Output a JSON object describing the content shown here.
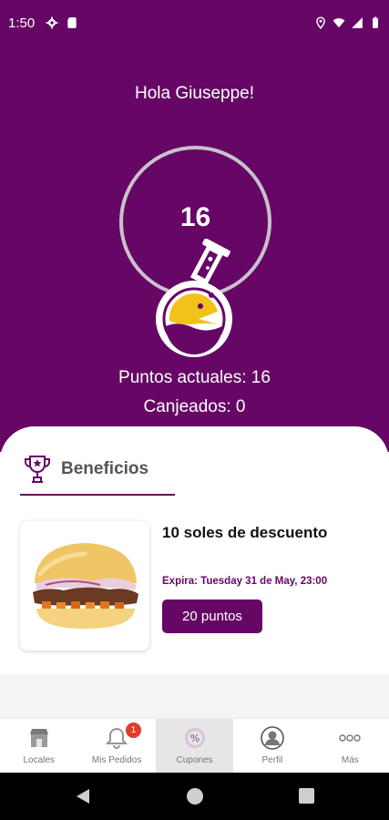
{
  "status_bar": {
    "time": "1:50",
    "left_icons": [
      "gear-icon",
      "sd-card-icon"
    ],
    "right_icons": [
      "location-icon",
      "wifi-icon",
      "signal-icon",
      "battery-icon"
    ]
  },
  "hero": {
    "greeting": "Hola Giuseppe!",
    "points": "16",
    "points_label": "Puntos actuales: 16",
    "redeemed_label": "Canjeados: 0"
  },
  "benefits": {
    "tab_label": "Beneficios",
    "coupons": [
      {
        "title": "10 soles de descuento",
        "expiry": "Expira: Tuesday 31 de May, 23:00",
        "points_button": "20 puntos",
        "image": "burger-image"
      }
    ]
  },
  "bottom_nav": {
    "items": [
      {
        "label": "Locales",
        "icon": "store-icon"
      },
      {
        "label": "Mis Pedidos",
        "icon": "bell-icon",
        "badge": "1"
      },
      {
        "label": "Cupones",
        "icon": "coupon-icon",
        "active": true
      },
      {
        "label": "Perfil",
        "icon": "person-icon"
      },
      {
        "label": "Más",
        "icon": "more-icon"
      }
    ]
  },
  "colors": {
    "brand_purple": "#660766",
    "badge_red": "#e23a2c",
    "mascot_yellow": "#f2c21a"
  }
}
